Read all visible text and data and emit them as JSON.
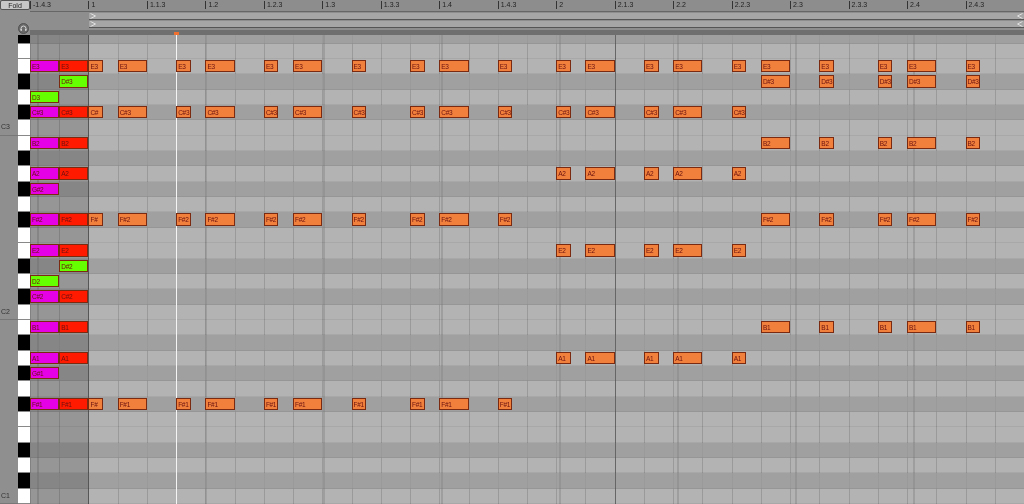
{
  "fold_button": "Fold",
  "ruler": {
    "labels": [
      "-1.4.3",
      "1",
      "1.1.3",
      "1.2",
      "1.2.3",
      "1.3",
      "1.3.3",
      "1.4",
      "1.4.3",
      "2",
      "2.1.3",
      "2.2",
      "2.2.3",
      "2.3",
      "2.3.3",
      "2.4",
      "2.4.3"
    ]
  },
  "rows": [
    {
      "black": true,
      "steps": []
    },
    {
      "black": false,
      "steps": []
    },
    {
      "black": false,
      "steps": [
        {
          "kind": "long",
          "label": "E3",
          "color": "#e600e6"
        },
        {
          "kind": "long",
          "label": "E3",
          "color": "#ff1a00"
        },
        {
          "kind": "short",
          "label": "E3",
          "color": "#f0803c"
        },
        {
          "kind": "rest"
        },
        {
          "kind": "long",
          "label": "E3",
          "color": "#f0803c"
        },
        {
          "kind": "rest"
        },
        {
          "kind": "rest"
        },
        {
          "kind": "short",
          "label": "E3",
          "color": "#f0803c"
        },
        {
          "kind": "rest"
        },
        {
          "kind": "long",
          "label": "E3",
          "color": "#f0803c"
        },
        {
          "kind": "rest"
        },
        {
          "kind": "rest"
        },
        {
          "kind": "short",
          "label": "E3",
          "color": "#f0803c"
        },
        {
          "kind": "rest"
        },
        {
          "kind": "long",
          "label": "E3",
          "color": "#f0803c"
        },
        {
          "kind": "rest"
        },
        {
          "kind": "rest"
        },
        {
          "kind": "short",
          "label": "E3",
          "color": "#f0803c"
        },
        {
          "kind": "rest"
        },
        {
          "kind": "rest"
        },
        {
          "kind": "rest"
        },
        {
          "kind": "short",
          "label": "E3",
          "color": "#f0803c"
        },
        {
          "kind": "rest"
        },
        {
          "kind": "long",
          "label": "E3",
          "color": "#f0803c"
        },
        {
          "kind": "rest"
        },
        {
          "kind": "rest"
        },
        {
          "kind": "short",
          "label": "E3",
          "color": "#f0803c"
        },
        {
          "kind": "rest"
        },
        {
          "kind": "rest"
        },
        {
          "kind": "rest"
        },
        {
          "kind": "short",
          "label": "E3",
          "color": "#f0803c"
        },
        {
          "kind": "rest"
        },
        {
          "kind": "long",
          "label": "E3",
          "color": "#f0803c"
        },
        {
          "kind": "rest"
        },
        {
          "kind": "rest"
        },
        {
          "kind": "short",
          "label": "E3",
          "color": "#f0803c"
        },
        {
          "kind": "rest"
        },
        {
          "kind": "long",
          "label": "E3",
          "color": "#f0803c"
        },
        {
          "kind": "rest"
        },
        {
          "kind": "rest"
        },
        {
          "kind": "short",
          "label": "E3",
          "color": "#f0803c"
        },
        {
          "kind": "rest"
        },
        {
          "kind": "long",
          "label": "E3",
          "color": "#f0803c"
        },
        {
          "kind": "rest"
        },
        {
          "kind": "rest"
        },
        {
          "kind": "short",
          "label": "E3",
          "color": "#f0803c"
        },
        {
          "kind": "rest"
        },
        {
          "kind": "rest"
        },
        {
          "kind": "rest"
        },
        {
          "kind": "short",
          "label": "E3",
          "color": "#f0803c"
        },
        {
          "kind": "rest"
        },
        {
          "kind": "long",
          "label": "E3",
          "color": "#f0803c"
        },
        {
          "kind": "rest"
        },
        {
          "kind": "rest"
        },
        {
          "kind": "short",
          "label": "E3",
          "color": "#f0803c"
        }
      ]
    },
    {
      "black": true,
      "steps": [
        {
          "kind": "rest"
        },
        {
          "kind": "rest"
        },
        {
          "kind": "long",
          "label": "D#3",
          "color": "#66ff00"
        },
        {
          "kind": "bar-rest"
        },
        {
          "kind": "beat-rest"
        },
        {
          "kind": "rest"
        },
        {
          "kind": "rest"
        },
        {
          "kind": "rest"
        },
        {
          "kind": "rest"
        },
        {
          "kind": "rest"
        },
        {
          "kind": "rest"
        },
        {
          "kind": "long",
          "label": "D#3",
          "color": "#f0803c"
        },
        {
          "kind": "rest"
        },
        {
          "kind": "rest"
        },
        {
          "kind": "short",
          "label": "D#3",
          "color": "#f0803c"
        },
        {
          "kind": "rest"
        },
        {
          "kind": "rest"
        },
        {
          "kind": "rest"
        },
        {
          "kind": "short",
          "label": "D#3",
          "color": "#f0803c"
        },
        {
          "kind": "rest"
        },
        {
          "kind": "long",
          "label": "D#3",
          "color": "#f0803c"
        },
        {
          "kind": "rest"
        },
        {
          "kind": "rest"
        },
        {
          "kind": "short",
          "label": "D#3",
          "color": "#f0803c"
        }
      ]
    },
    {
      "black": false,
      "steps": [
        {
          "kind": "long",
          "label": "D3",
          "color": "#66ff00"
        }
      ]
    },
    {
      "black": true,
      "steps": [
        {
          "kind": "long",
          "label": "C#3",
          "color": "#e600e6"
        },
        {
          "kind": "long",
          "label": "C#3",
          "color": "#ff1a00"
        },
        {
          "kind": "short",
          "label": "C#",
          "color": "#f0803c"
        },
        {
          "kind": "rest"
        },
        {
          "kind": "long",
          "label": "C#3",
          "color": "#f0803c"
        },
        {
          "kind": "rest"
        },
        {
          "kind": "rest"
        },
        {
          "kind": "short",
          "label": "C#3",
          "color": "#f0803c"
        },
        {
          "kind": "rest"
        },
        {
          "kind": "long",
          "label": "C#3",
          "color": "#f0803c"
        },
        {
          "kind": "rest"
        },
        {
          "kind": "rest"
        },
        {
          "kind": "short",
          "label": "C#3",
          "color": "#f0803c"
        },
        {
          "kind": "rest"
        },
        {
          "kind": "long",
          "label": "C#3",
          "color": "#f0803c"
        },
        {
          "kind": "rest"
        },
        {
          "kind": "rest"
        },
        {
          "kind": "short",
          "label": "C#3",
          "color": "#f0803c"
        },
        {
          "kind": "rest"
        },
        {
          "kind": "rest"
        },
        {
          "kind": "rest"
        },
        {
          "kind": "short",
          "label": "C#3",
          "color": "#f0803c"
        },
        {
          "kind": "rest"
        },
        {
          "kind": "long",
          "label": "C#3",
          "color": "#f0803c"
        },
        {
          "kind": "rest"
        },
        {
          "kind": "rest"
        },
        {
          "kind": "short",
          "label": "C#3",
          "color": "#f0803c"
        },
        {
          "kind": "rest"
        },
        {
          "kind": "rest"
        },
        {
          "kind": "rest"
        },
        {
          "kind": "short",
          "label": "C#3",
          "color": "#f0803c"
        },
        {
          "kind": "rest"
        },
        {
          "kind": "long",
          "label": "C#3",
          "color": "#f0803c"
        },
        {
          "kind": "rest"
        },
        {
          "kind": "rest"
        },
        {
          "kind": "short",
          "label": "C#3",
          "color": "#f0803c"
        },
        {
          "kind": "rest"
        },
        {
          "kind": "long",
          "label": "C#3",
          "color": "#f0803c"
        },
        {
          "kind": "rest"
        },
        {
          "kind": "rest"
        },
        {
          "kind": "short",
          "label": "C#3",
          "color": "#f0803c"
        }
      ]
    },
    {
      "black": false,
      "octave_label": "C3",
      "steps": []
    },
    {
      "black": false,
      "steps": [
        {
          "kind": "long",
          "label": "B2",
          "color": "#e600e6"
        },
        {
          "kind": "long",
          "label": "B2",
          "color": "#ff1a00"
        },
        {
          "kind": "bar-rest"
        },
        {
          "kind": "beat-rest"
        },
        {
          "kind": "rest"
        },
        {
          "kind": "rest"
        },
        {
          "kind": "rest"
        },
        {
          "kind": "rest"
        },
        {
          "kind": "rest"
        },
        {
          "kind": "rest"
        },
        {
          "kind": "long",
          "label": "B2",
          "color": "#f0803c"
        },
        {
          "kind": "rest"
        },
        {
          "kind": "rest"
        },
        {
          "kind": "short",
          "label": "B2",
          "color": "#f0803c"
        },
        {
          "kind": "rest"
        },
        {
          "kind": "rest"
        },
        {
          "kind": "rest"
        },
        {
          "kind": "short",
          "label": "B2",
          "color": "#f0803c"
        },
        {
          "kind": "rest"
        },
        {
          "kind": "long",
          "label": "B2",
          "color": "#f0803c"
        },
        {
          "kind": "rest"
        },
        {
          "kind": "rest"
        },
        {
          "kind": "short",
          "label": "B2",
          "color": "#f0803c"
        }
      ]
    },
    {
      "black": true,
      "steps": []
    },
    {
      "black": false,
      "steps": [
        {
          "kind": "long",
          "label": "A2",
          "color": "#e600e6"
        },
        {
          "kind": "long",
          "label": "A2",
          "color": "#ff1a00"
        },
        {
          "kind": "bar-rest"
        },
        {
          "kind": "short",
          "label": "A2",
          "color": "#f0803c"
        },
        {
          "kind": "rest"
        },
        {
          "kind": "long",
          "label": "A2",
          "color": "#f0803c"
        },
        {
          "kind": "rest"
        },
        {
          "kind": "rest"
        },
        {
          "kind": "short",
          "label": "A2",
          "color": "#f0803c"
        },
        {
          "kind": "rest"
        },
        {
          "kind": "long",
          "label": "A2",
          "color": "#f0803c"
        },
        {
          "kind": "rest"
        },
        {
          "kind": "rest"
        },
        {
          "kind": "short",
          "label": "A2",
          "color": "#f0803c"
        }
      ]
    },
    {
      "black": true,
      "steps": [
        {
          "kind": "long",
          "label": "G#2",
          "color": "#e600e6"
        }
      ]
    },
    {
      "black": false,
      "steps": []
    },
    {
      "black": true,
      "steps": [
        {
          "kind": "long",
          "label": "F#2",
          "color": "#e600e6"
        },
        {
          "kind": "long",
          "label": "F#2",
          "color": "#ff1a00"
        },
        {
          "kind": "short",
          "label": "F#",
          "color": "#f0803c"
        },
        {
          "kind": "rest"
        },
        {
          "kind": "long",
          "label": "F#2",
          "color": "#f0803c"
        },
        {
          "kind": "rest"
        },
        {
          "kind": "rest"
        },
        {
          "kind": "short",
          "label": "F#2",
          "color": "#f0803c"
        },
        {
          "kind": "rest"
        },
        {
          "kind": "long",
          "label": "F#2",
          "color": "#f0803c"
        },
        {
          "kind": "rest"
        },
        {
          "kind": "rest"
        },
        {
          "kind": "short",
          "label": "F#2",
          "color": "#f0803c"
        },
        {
          "kind": "rest"
        },
        {
          "kind": "long",
          "label": "F#2",
          "color": "#f0803c"
        },
        {
          "kind": "rest"
        },
        {
          "kind": "rest"
        },
        {
          "kind": "short",
          "label": "F#2",
          "color": "#f0803c"
        },
        {
          "kind": "rest"
        },
        {
          "kind": "rest"
        },
        {
          "kind": "rest"
        },
        {
          "kind": "short",
          "label": "F#2",
          "color": "#f0803c"
        },
        {
          "kind": "rest"
        },
        {
          "kind": "long",
          "label": "F#2",
          "color": "#f0803c"
        },
        {
          "kind": "rest"
        },
        {
          "kind": "rest"
        },
        {
          "kind": "short",
          "label": "F#2",
          "color": "#f0803c"
        },
        {
          "kind": "rest"
        },
        {
          "kind": "rest"
        },
        {
          "kind": "rest"
        },
        {
          "kind": "beat-rest"
        },
        {
          "kind": "rest"
        },
        {
          "kind": "rest"
        },
        {
          "kind": "rest"
        },
        {
          "kind": "rest"
        },
        {
          "kind": "rest"
        },
        {
          "kind": "rest"
        },
        {
          "kind": "long",
          "label": "F#2",
          "color": "#f0803c"
        },
        {
          "kind": "rest"
        },
        {
          "kind": "rest"
        },
        {
          "kind": "short",
          "label": "F#2",
          "color": "#f0803c"
        },
        {
          "kind": "rest"
        },
        {
          "kind": "rest"
        },
        {
          "kind": "rest"
        },
        {
          "kind": "short",
          "label": "F#2",
          "color": "#f0803c"
        },
        {
          "kind": "rest"
        },
        {
          "kind": "long",
          "label": "F#2",
          "color": "#f0803c"
        },
        {
          "kind": "rest"
        },
        {
          "kind": "rest"
        },
        {
          "kind": "short",
          "label": "F#2",
          "color": "#f0803c"
        }
      ]
    },
    {
      "black": false,
      "steps": []
    },
    {
      "black": false,
      "steps": [
        {
          "kind": "long",
          "label": "E2",
          "color": "#e600e6"
        },
        {
          "kind": "long",
          "label": "E2",
          "color": "#ff1a00"
        },
        {
          "kind": "bar-rest"
        },
        {
          "kind": "short",
          "label": "E2",
          "color": "#f0803c"
        },
        {
          "kind": "rest"
        },
        {
          "kind": "long",
          "label": "E2",
          "color": "#f0803c"
        },
        {
          "kind": "rest"
        },
        {
          "kind": "rest"
        },
        {
          "kind": "short",
          "label": "E2",
          "color": "#f0803c"
        },
        {
          "kind": "rest"
        },
        {
          "kind": "long",
          "label": "E2",
          "color": "#f0803c"
        },
        {
          "kind": "rest"
        },
        {
          "kind": "rest"
        },
        {
          "kind": "short",
          "label": "E2",
          "color": "#f0803c"
        }
      ]
    },
    {
      "black": true,
      "steps": [
        {
          "kind": "rest"
        },
        {
          "kind": "rest"
        },
        {
          "kind": "long",
          "label": "D#2",
          "color": "#66ff00"
        }
      ]
    },
    {
      "black": false,
      "steps": [
        {
          "kind": "long",
          "label": "D2",
          "color": "#66ff00"
        }
      ]
    },
    {
      "black": true,
      "steps": [
        {
          "kind": "long",
          "label": "C#2",
          "color": "#e600e6"
        },
        {
          "kind": "long",
          "label": "C#2",
          "color": "#ff1a00"
        }
      ]
    },
    {
      "black": false,
      "octave_label": "C2",
      "steps": []
    },
    {
      "black": false,
      "steps": [
        {
          "kind": "long",
          "label": "B1",
          "color": "#e600e6"
        },
        {
          "kind": "long",
          "label": "B1",
          "color": "#ff1a00"
        },
        {
          "kind": "bar-rest"
        },
        {
          "kind": "beat-rest"
        },
        {
          "kind": "rest"
        },
        {
          "kind": "rest"
        },
        {
          "kind": "rest"
        },
        {
          "kind": "rest"
        },
        {
          "kind": "rest"
        },
        {
          "kind": "rest"
        },
        {
          "kind": "long",
          "label": "B1",
          "color": "#f0803c"
        },
        {
          "kind": "rest"
        },
        {
          "kind": "rest"
        },
        {
          "kind": "short",
          "label": "B1",
          "color": "#f0803c"
        },
        {
          "kind": "rest"
        },
        {
          "kind": "rest"
        },
        {
          "kind": "rest"
        },
        {
          "kind": "short",
          "label": "B1",
          "color": "#f0803c"
        },
        {
          "kind": "rest"
        },
        {
          "kind": "long",
          "label": "B1",
          "color": "#f0803c"
        },
        {
          "kind": "rest"
        },
        {
          "kind": "rest"
        },
        {
          "kind": "short",
          "label": "B1",
          "color": "#f0803c"
        }
      ]
    },
    {
      "black": true,
      "steps": []
    },
    {
      "black": false,
      "steps": [
        {
          "kind": "long",
          "label": "A1",
          "color": "#e600e6"
        },
        {
          "kind": "long",
          "label": "A1",
          "color": "#ff1a00"
        },
        {
          "kind": "bar-rest"
        },
        {
          "kind": "short",
          "label": "A1",
          "color": "#f0803c"
        },
        {
          "kind": "rest"
        },
        {
          "kind": "long",
          "label": "A1",
          "color": "#f0803c"
        },
        {
          "kind": "rest"
        },
        {
          "kind": "rest"
        },
        {
          "kind": "short",
          "label": "A1",
          "color": "#f0803c"
        },
        {
          "kind": "rest"
        },
        {
          "kind": "long",
          "label": "A1",
          "color": "#f0803c"
        },
        {
          "kind": "rest"
        },
        {
          "kind": "rest"
        },
        {
          "kind": "short",
          "label": "A1",
          "color": "#f0803c"
        }
      ]
    },
    {
      "black": true,
      "steps": [
        {
          "kind": "long",
          "label": "G#1",
          "color": "#e600e6"
        }
      ]
    },
    {
      "black": false,
      "steps": []
    },
    {
      "black": true,
      "steps": [
        {
          "kind": "long",
          "label": "F#1",
          "color": "#e600e6"
        },
        {
          "kind": "long",
          "label": "F#1",
          "color": "#ff1a00"
        },
        {
          "kind": "short",
          "label": "F#",
          "color": "#f0803c"
        },
        {
          "kind": "rest"
        },
        {
          "kind": "long",
          "label": "F#1",
          "color": "#f0803c"
        },
        {
          "kind": "rest"
        },
        {
          "kind": "rest"
        },
        {
          "kind": "short",
          "label": "F#1",
          "color": "#f0803c"
        },
        {
          "kind": "rest"
        },
        {
          "kind": "long",
          "label": "F#1",
          "color": "#f0803c"
        },
        {
          "kind": "rest"
        },
        {
          "kind": "rest"
        },
        {
          "kind": "short",
          "label": "F#1",
          "color": "#f0803c"
        },
        {
          "kind": "rest"
        },
        {
          "kind": "long",
          "label": "F#1",
          "color": "#f0803c"
        },
        {
          "kind": "rest"
        },
        {
          "kind": "rest"
        },
        {
          "kind": "short",
          "label": "F#1",
          "color": "#f0803c"
        },
        {
          "kind": "rest"
        },
        {
          "kind": "rest"
        },
        {
          "kind": "rest"
        },
        {
          "kind": "short",
          "label": "F#1",
          "color": "#f0803c"
        },
        {
          "kind": "rest"
        },
        {
          "kind": "long",
          "label": "F#1",
          "color": "#f0803c"
        },
        {
          "kind": "rest"
        },
        {
          "kind": "rest"
        },
        {
          "kind": "short",
          "label": "F#1",
          "color": "#f0803c"
        }
      ]
    },
    {
      "black": false,
      "steps": []
    },
    {
      "black": false,
      "steps": []
    },
    {
      "black": true,
      "steps": []
    },
    {
      "black": false,
      "steps": []
    },
    {
      "black": true,
      "steps": []
    },
    {
      "black": false,
      "octave_label": "C1",
      "steps": []
    }
  ]
}
